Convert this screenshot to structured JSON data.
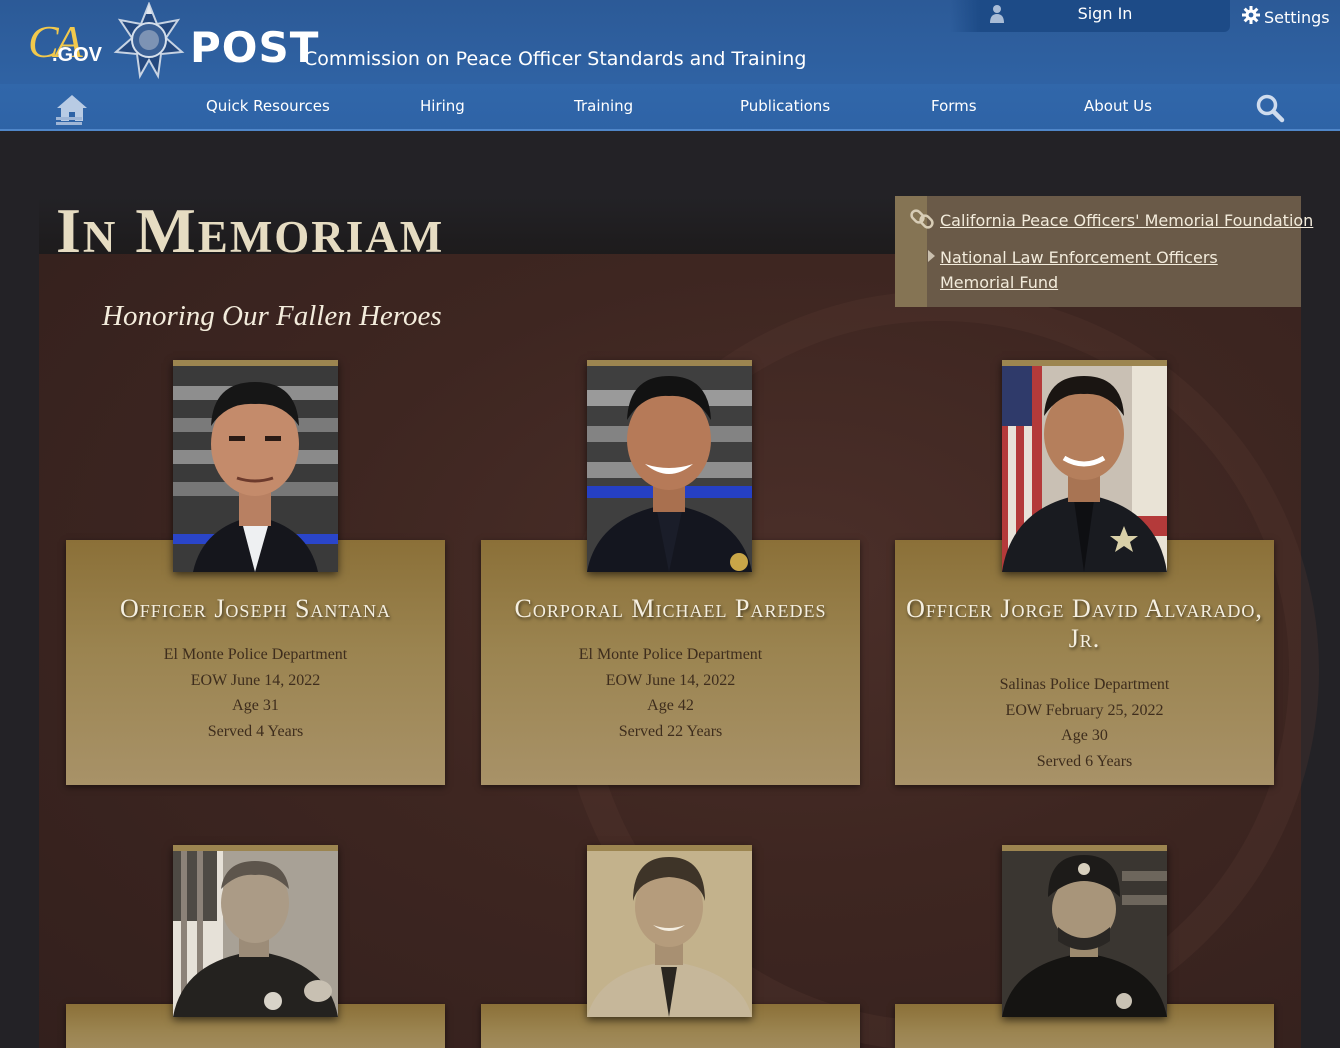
{
  "header": {
    "ca_logo": {
      "ca": "CA",
      "gov": ".GOV"
    },
    "site_title": "POST",
    "site_subtitle": "Commission on Peace Officer Standards and Training",
    "signin_label": "Sign In",
    "settings_label": "Settings",
    "nav": [
      {
        "label": "Quick Resources"
      },
      {
        "label": "Hiring"
      },
      {
        "label": "Training"
      },
      {
        "label": "Publications"
      },
      {
        "label": "Forms"
      },
      {
        "label": "About Us"
      }
    ],
    "icons": [
      "home-icon",
      "search-icon",
      "user-icon",
      "gear-icon"
    ]
  },
  "page": {
    "title": "In Memoriam",
    "subtitle": "Honoring Our Fallen Heroes"
  },
  "links": [
    {
      "label": "California Peace Officers' Memorial Foundation"
    },
    {
      "label": "National Law Enforcement Officers Memorial Fund"
    }
  ],
  "officers": [
    {
      "name": "Officer Joseph Santana",
      "department": "El Monte Police Department",
      "eow": "EOW June 14, 2022",
      "age": "Age 31",
      "served": "Served 4 Years"
    },
    {
      "name": "Corporal Michael Paredes",
      "department": "El Monte Police Department",
      "eow": "EOW June 14, 2022",
      "age": "Age 42",
      "served": "Served 22 Years"
    },
    {
      "name": "Officer Jorge David Alvarado, Jr.",
      "department": "Salinas Police Department",
      "eow": "EOW February 25, 2022",
      "age": "Age 30",
      "served": "Served 6 Years"
    }
  ],
  "colors": {
    "header_blue": "#2f62a3",
    "gold_accent": "#f2c94c",
    "card_gold": "#9b8450",
    "title_cream": "#e6dcc2",
    "frame_brown": "#3e2621"
  }
}
